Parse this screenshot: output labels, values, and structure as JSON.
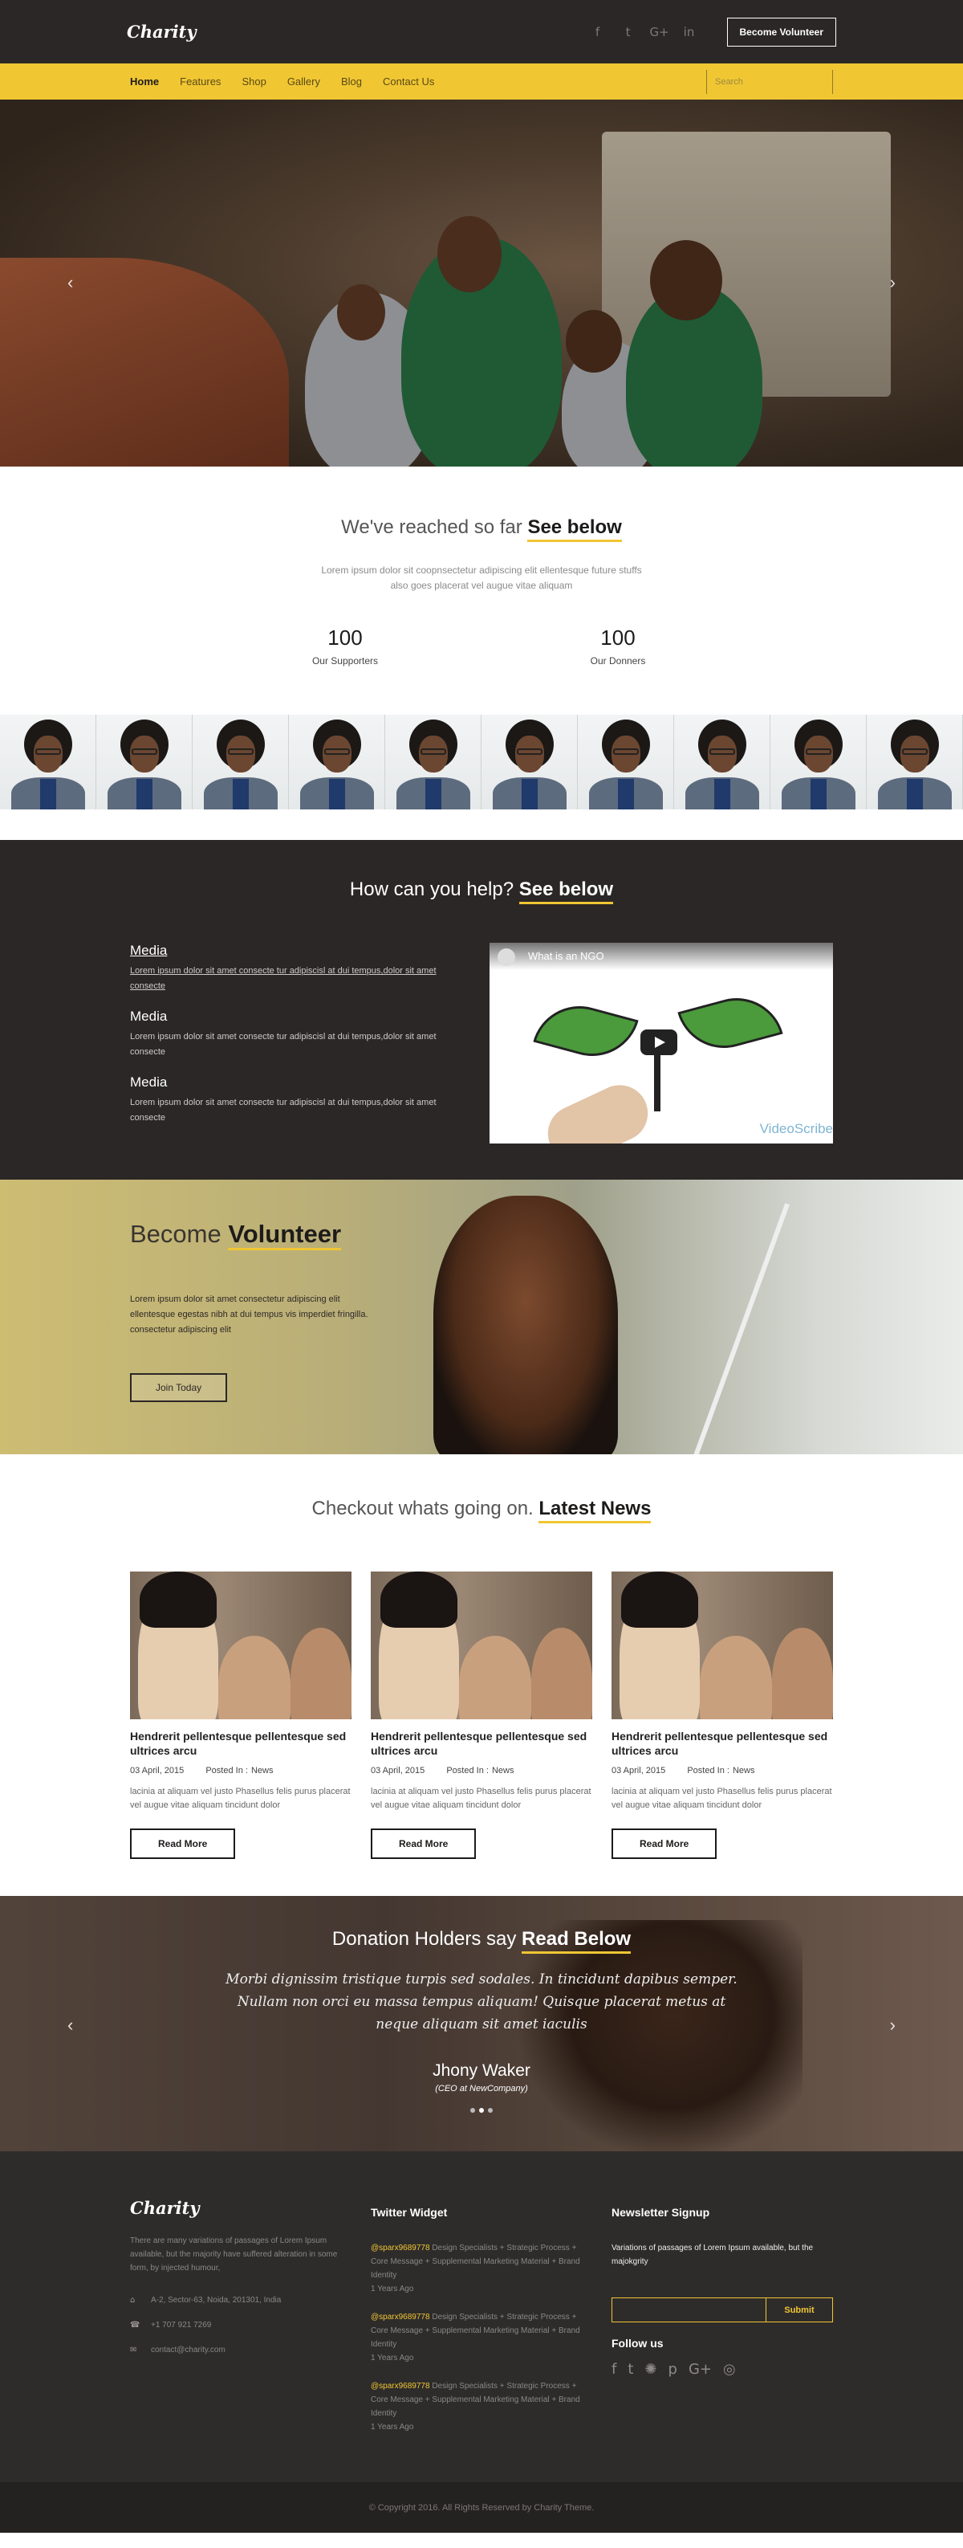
{
  "header": {
    "logo": "Charity",
    "social_icons": [
      "facebook-icon",
      "twitter-icon",
      "google-plus-icon",
      "linkedin-icon"
    ],
    "social_glyphs": [
      "f",
      "t",
      "G+",
      "in"
    ],
    "cta": "Become Volunteer"
  },
  "nav": {
    "items": [
      "Home",
      "Features",
      "Shop",
      "Gallery",
      "Blog",
      "Contact Us"
    ],
    "active": "Home",
    "search_placeholder": "Search"
  },
  "hero": {
    "prev": "‹",
    "next": "›"
  },
  "stats": {
    "heading_light": "We've reached so far",
    "heading_bold": "See below",
    "text": "Lorem ipsum dolor sit coopnsectetur adipiscing elit ellentesque future stuffs also goes placerat vel augue vitae aliquam",
    "counters": [
      {
        "value": "100",
        "label": "Our Supporters"
      },
      {
        "value": "100",
        "label": "Our Donners"
      }
    ]
  },
  "help": {
    "heading_light": "How can you help?",
    "heading_bold": "See below",
    "items": [
      {
        "title": "Media",
        "text": "Lorem ipsum dolor sit amet consecte tur adipiscisl at dui tempus,dolor sit amet consecte"
      },
      {
        "title": "Media",
        "text": "Lorem ipsum dolor sit amet consecte tur adipiscisl at dui tempus,dolor sit amet consecte"
      },
      {
        "title": "Media",
        "text": "Lorem ipsum dolor sit amet consecte tur adipiscisl at dui tempus,dolor sit amet consecte"
      }
    ],
    "video": {
      "title": "What is an NGO",
      "brand": "VideoScribe"
    }
  },
  "volunteer": {
    "title_light": "Become",
    "title_bold": "Volunteer",
    "text": "Lorem ipsum dolor sit amet consectetur adipiscing elit ellentesque egestas nibh at dui tempus vis imperdiet fringilla. consectetur adipiscing elit",
    "button": "Join Today"
  },
  "news": {
    "heading_light": "Checkout whats going on.",
    "heading_bold": "Latest News",
    "posted_prefix": "Posted In :",
    "cards": [
      {
        "title": "Hendrerit pellentesque pellentesque sed ultrices arcu",
        "date": "03 April, 2015",
        "category": "News",
        "text": "lacinia at aliquam vel justo Phasellus felis purus placerat vel augue vitae aliquam tincidunt dolor",
        "button": "Read More"
      },
      {
        "title": "Hendrerit pellentesque pellentesque sed ultrices arcu",
        "date": "03 April, 2015",
        "category": "News",
        "text": "lacinia at aliquam vel justo Phasellus felis purus placerat vel augue vitae aliquam tincidunt dolor",
        "button": "Read More"
      },
      {
        "title": "Hendrerit pellentesque pellentesque sed ultrices arcu",
        "date": "03 April, 2015",
        "category": "News",
        "text": "lacinia at aliquam vel justo Phasellus felis purus placerat vel augue vitae aliquam tincidunt dolor",
        "button": "Read More"
      }
    ]
  },
  "testimonial": {
    "heading_light": "Donation Holders say",
    "heading_bold": "Read Below",
    "quote": "Morbi dignissim tristique turpis sed sodales. In tincidunt dapibus semper. Nullam non orci eu massa tempus aliquam! Quisque placerat metus at neque aliquam sit amet iaculis",
    "author": "Jhony Waker",
    "role": "(CEO at NewCompany)",
    "slides": 3,
    "active_slide": 2,
    "prev": "‹",
    "next": "›"
  },
  "footer": {
    "logo": "Charity",
    "about": "There are many variations of passages of Lorem Ipsum available, but the majority have suffered alteration in some form, by injected humour,",
    "address": "A-2, Sector-63, Noida, 201301, India",
    "phone": "+1 707 921 7269",
    "email": "contact@charity.com",
    "twitter_title": "Twitter Widget",
    "tweets": [
      {
        "handle": "@sparx9689778",
        "text": "Design Specialists + Strategic Process + Core Message + Supplemental Marketing Material + Brand Identity",
        "time": "1 Years Ago"
      },
      {
        "handle": "@sparx9689778",
        "text": "Design Specialists + Strategic Process + Core Message + Supplemental Marketing Material + Brand Identity",
        "time": "1 Years Ago"
      },
      {
        "handle": "@sparx9689778",
        "text": "Design Specialists + Strategic Process + Core Message + Supplemental Marketing Material + Brand Identity",
        "time": "1 Years Ago"
      }
    ],
    "newsletter_title": "Newsletter Signup",
    "newsletter_text": "Variations of passages of Lorem Ipsum available, but the majokgrity",
    "submit": "Submit",
    "follow": "Follow us",
    "follow_icons": [
      "facebook-icon",
      "twitter-icon",
      "dribbble-icon",
      "pinterest-icon",
      "google-plus-icon",
      "instagram-icon"
    ],
    "follow_glyphs": [
      "f",
      "t",
      "✺",
      "p",
      "G+",
      "◎"
    ],
    "copyright": "© Copyright 2016. All Rights Reserved by Charity Theme."
  },
  "colors": {
    "accent": "#f0c633",
    "dark": "#2b2726"
  }
}
